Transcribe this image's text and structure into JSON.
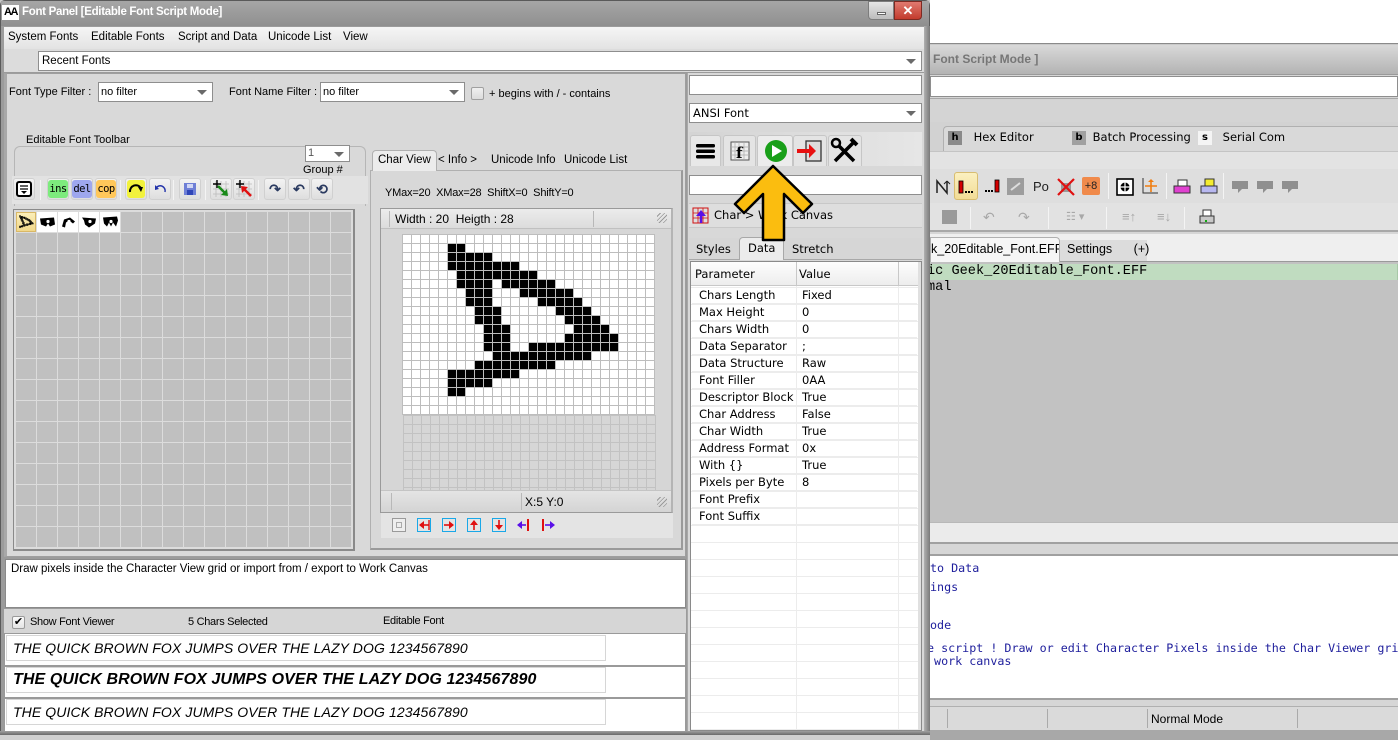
{
  "bg_window": {
    "title": "Font Script Mode ]",
    "tabs": [
      {
        "key": "h",
        "label": "Hex Editor"
      },
      {
        "key": "b",
        "label": "Batch Processing"
      },
      {
        "key": "s",
        "label": "Serial Com"
      }
    ],
    "toolbar_text": {
      "po": "Po",
      "plus8": "+8"
    },
    "doc_tabs": [
      "k_20Editable_Font.EFF",
      "Settings",
      "(+)"
    ],
    "editor_lines": [
      "ic Geek_20Editable_Font.EFF",
      "mal"
    ],
    "console_lines": [
      "to Data",
      "ings",
      "ode",
      "e script ! Draw or edit Character Pixels inside the Char Viewer gri",
      " work canvas"
    ],
    "status_mode": "Normal Mode"
  },
  "window": {
    "icon": "AA",
    "title": "Font Panel [Editable Font Script Mode]"
  },
  "menu": {
    "items": [
      "System Fonts",
      "Editable Fonts",
      "Script and Data",
      "Unicode List",
      "View"
    ]
  },
  "recent_fonts": {
    "value": "Recent Fonts"
  },
  "filters": {
    "font_type_label": "Font Type Filter :",
    "font_type_value": "no filter",
    "font_name_label": "Font Name Filter :",
    "font_name_value": "no filter",
    "match_mode_label": "+ begins with / - contains",
    "match_mode_checked": false
  },
  "toolbar": {
    "title": "Editable Font Toolbar",
    "group_value": "1",
    "group_label": "Group #",
    "ins": "ins",
    "del": "del",
    "cop": "cop"
  },
  "char_grid": {
    "columns": 16,
    "rows": 16,
    "filled_count": 5,
    "selected_index": 0
  },
  "char_view": {
    "tabs": [
      "Char View",
      "< Info >",
      "Unicode Info",
      "Unicode List"
    ],
    "active_tab": 0,
    "metrics": "YMax=20  XMax=28  ShiftX=0  ShiftY=0",
    "size_label": "Width : 20  Heigth : 28",
    "cursor": "X:5 Y:0",
    "pixels": [
      "............................",
      ".....##.....................",
      ".....#####..................",
      ".....########...............",
      "......#########.............",
      "......####.######...........",
      ".......###...######.........",
      ".......###.....#####........",
      "........###......####.......",
      "........###.......####......",
      ".........###.......####.....",
      ".........###......######....",
      ".........###..##########....",
      "..........###########.......",
      "........#########...........",
      ".....########...............",
      ".....#####..................",
      ".....##.....................",
      "............................",
      "............................"
    ]
  },
  "info_text": "Draw pixels inside the Character View grid or import from / export to Work Canvas",
  "viewer_bar": {
    "show_font_viewer_label": "Show Font Viewer",
    "show_font_viewer_checked": true,
    "selection": "5 Chars Selected",
    "font_kind": "Editable Font"
  },
  "previews": [
    "THE QUICK BROWN FOX JUMPS OVER THE LAZY DOG 1234567890",
    "THE QUICK BROWN FOX JUMPS OVER THE LAZY DOG 1234567890",
    "THE QUICK BROWN FOX JUMPS OVER THE LAZY DOG 1234567890"
  ],
  "right_panel": {
    "top_input": "",
    "encoding": "ANSI Font",
    "search": "",
    "char_to_canvas": "Char > Work Canvas",
    "tabs": [
      "Styles",
      "Data",
      "Stretch"
    ],
    "active_tab": 1,
    "table": {
      "headers": [
        "Parameter",
        "Value"
      ],
      "rows": [
        {
          "param": "Chars Length",
          "value": "Fixed"
        },
        {
          "param": "Max Height",
          "value": "0"
        },
        {
          "param": "Chars Width",
          "value": "0"
        },
        {
          "param": "Data Separator",
          "value": ";"
        },
        {
          "param": "Data Structure",
          "value": "Raw"
        },
        {
          "param": "Font Filler",
          "value": "0AA"
        },
        {
          "param": "Descriptor Block",
          "value": "True"
        },
        {
          "param": "Char Address",
          "value": "False"
        },
        {
          "param": "Char Width",
          "value": "True"
        },
        {
          "param": "Address Format",
          "value": "0x"
        },
        {
          "param": "With {}",
          "value": "True"
        },
        {
          "param": "Pixels per Byte",
          "value": "8"
        },
        {
          "param": "Font Prefix",
          "value": ""
        },
        {
          "param": "Font Suffix",
          "value": ""
        }
      ]
    }
  },
  "colors": {
    "accent_play": "#1aa01a",
    "annotation_arrow": "#fbbd0f",
    "console_text": "#1e1e9c",
    "highlight_line": "#c0dcc0"
  }
}
